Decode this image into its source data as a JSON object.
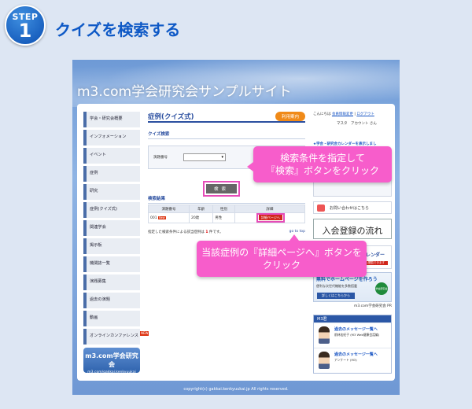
{
  "step": {
    "label": "STEP",
    "number": "1",
    "title": "クイズを検索する"
  },
  "site": {
    "title": "m3.com学会研究会サンプルサイト",
    "copyright": "copyright(c) gakkai.kenkyuukai.jp All rights reserved."
  },
  "nav": {
    "items": [
      {
        "label": "学会・研究会概要"
      },
      {
        "label": "インフォメーション"
      },
      {
        "label": "イベント"
      },
      {
        "label": "症例"
      },
      {
        "label": "研究"
      },
      {
        "label": "症例(クイズ式)"
      },
      {
        "label": "関連学会"
      },
      {
        "label": "掲示板"
      },
      {
        "label": "機関誌一覧"
      },
      {
        "label": "演題募集"
      },
      {
        "label": "過去の演題"
      },
      {
        "label": "動画"
      },
      {
        "label": "オンラインカンファレンス",
        "badge": "NEW"
      }
    ],
    "logo_main": "m3.com学会研究会",
    "logo_sub": "m3.com/gakkai.kenkyuukai"
  },
  "main": {
    "title": "症例(クイズ式)",
    "usage_button": "利用案内",
    "search_heading": "クイズ検索",
    "field_label": "演題番号",
    "search_button": "検索",
    "results_heading": "検索結果",
    "columns": [
      "演題番号",
      "年齢",
      "性別",
      "詳細"
    ],
    "rows": [
      {
        "number": "001",
        "badge": "New",
        "age": "20歳",
        "sex": "男性",
        "detail": "詳細ページへ"
      }
    ],
    "result_note_prefix": "指定した検索条件による該当症例は",
    "result_count": "1",
    "result_note_suffix": "件です。",
    "goto_top": "go to top"
  },
  "sidebar": {
    "greeting": "こんにちは",
    "member_link": "会員情報変更",
    "logout_link": "ログアウト",
    "user_label": "マスタ　アカウント さん",
    "calendar_link": "★学会・研究会カレンダーを表示しまし",
    "contact": "お問い合わせはこちら",
    "join": "入会登録の流れ",
    "calendar_title": "レンダー",
    "calendar_bar": "iPhone・iPadからも閲覧できます",
    "hp_title": "無料でホームページを作ろう",
    "hp_sub": "便利な次世代機能を多数搭載",
    "hp_button": "詳しくはこちらから",
    "hp_seal": "学会研究会",
    "pr": "m3.com学会研究会 PR",
    "messages_head": "M3君",
    "messages": [
      {
        "title": "過去のメッセージ一覧へ",
        "sub": "前林宏紀子 (M3 Web健康会話編)"
      },
      {
        "title": "過去のメッセージ一覧へ",
        "sub": "アンケート (M3)"
      }
    ]
  },
  "callouts": {
    "search": "検索条件を指定して\n『検索』ボタンをクリック",
    "detail": "当該症例の『詳細ページへ』ボタンを\nクリック"
  },
  "colors": {
    "accent": "#0e59c6",
    "callout": "#f75dcb",
    "orange": "#f08a18",
    "red": "#d0261c"
  }
}
